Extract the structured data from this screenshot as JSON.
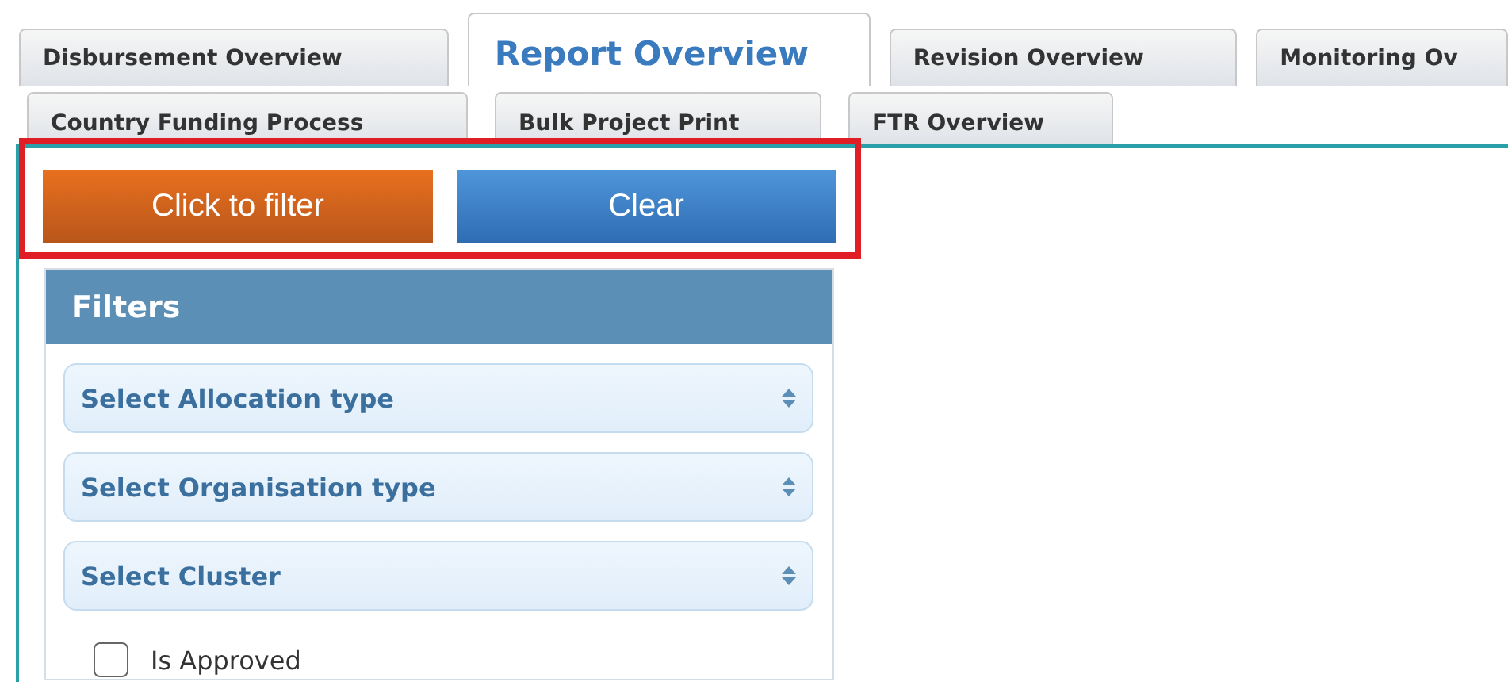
{
  "tabs_row_1": [
    {
      "label": "Disbursement Overview",
      "selected": false
    },
    {
      "label": "Report Overview",
      "selected": true
    },
    {
      "label": "Revision Overview",
      "selected": false
    },
    {
      "label": "Monitoring Ov",
      "selected": false
    }
  ],
  "tabs_row_2": [
    {
      "label": "Country Funding Process",
      "selected": false
    },
    {
      "label": "Bulk Project Print",
      "selected": false
    },
    {
      "label": "FTR Overview",
      "selected": false
    }
  ],
  "actions": [
    {
      "label": "Click to filter",
      "kind": "primary"
    },
    {
      "label": "Clear",
      "kind": "secondary"
    }
  ],
  "filters": {
    "title": "Filters",
    "selects": [
      {
        "placeholder": "Select Allocation type"
      },
      {
        "placeholder": "Select Organisation type"
      },
      {
        "placeholder": "Select Cluster"
      }
    ],
    "checkboxes": [
      {
        "label": "Is Approved",
        "checked": false
      }
    ]
  }
}
